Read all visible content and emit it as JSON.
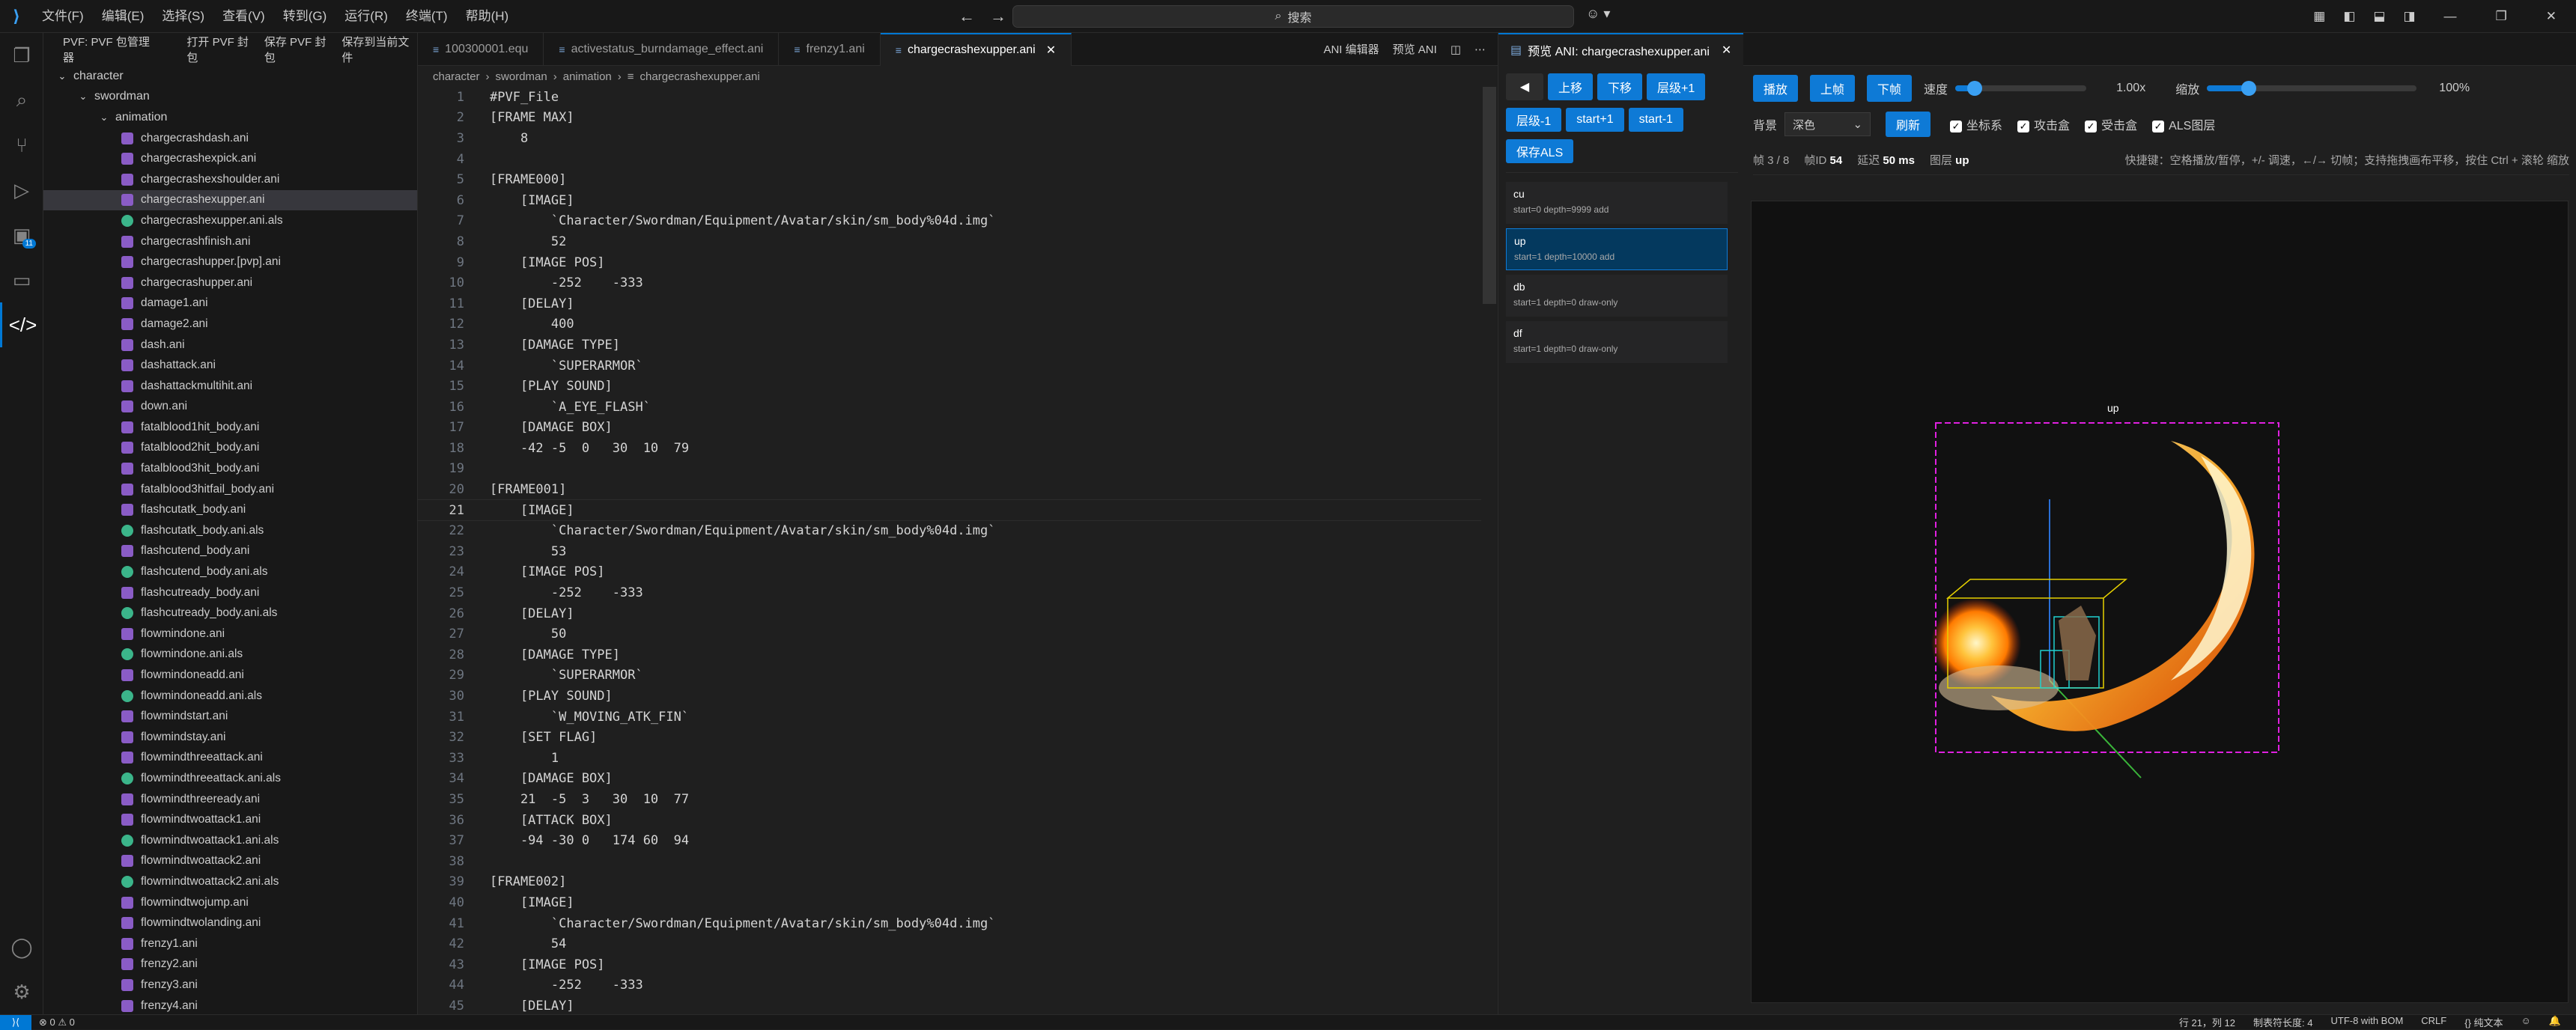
{
  "titlebar": {
    "menu": [
      "文件(F)",
      "编辑(E)",
      "选择(S)",
      "查看(V)",
      "转到(G)",
      "运行(R)",
      "终端(T)",
      "帮助(H)"
    ],
    "search_placeholder": "搜索"
  },
  "sidebar": {
    "header_items": [
      "PVF: PVF 包管理器",
      "打开 PVF 封包",
      "保存 PVF 封包",
      "保存到当前文件"
    ],
    "folders": [
      "character",
      "swordman",
      "animation"
    ],
    "files": [
      {
        "name": "chargecrashdash.ani",
        "type": "ani"
      },
      {
        "name": "chargecrashexpick.ani",
        "type": "ani"
      },
      {
        "name": "chargecrashexshoulder.ani",
        "type": "ani"
      },
      {
        "name": "chargecrashexupper.ani",
        "type": "ani",
        "selected": true
      },
      {
        "name": "chargecrashexupper.ani.als",
        "type": "als"
      },
      {
        "name": "chargecrashfinish.ani",
        "type": "ani"
      },
      {
        "name": "chargecrashupper.[pvp].ani",
        "type": "ani"
      },
      {
        "name": "chargecrashupper.ani",
        "type": "ani"
      },
      {
        "name": "damage1.ani",
        "type": "ani"
      },
      {
        "name": "damage2.ani",
        "type": "ani"
      },
      {
        "name": "dash.ani",
        "type": "ani"
      },
      {
        "name": "dashattack.ani",
        "type": "ani"
      },
      {
        "name": "dashattackmultihit.ani",
        "type": "ani"
      },
      {
        "name": "down.ani",
        "type": "ani"
      },
      {
        "name": "fatalblood1hit_body.ani",
        "type": "ani"
      },
      {
        "name": "fatalblood2hit_body.ani",
        "type": "ani"
      },
      {
        "name": "fatalblood3hit_body.ani",
        "type": "ani"
      },
      {
        "name": "fatalblood3hitfail_body.ani",
        "type": "ani"
      },
      {
        "name": "flashcutatk_body.ani",
        "type": "ani"
      },
      {
        "name": "flashcutatk_body.ani.als",
        "type": "als"
      },
      {
        "name": "flashcutend_body.ani",
        "type": "ani"
      },
      {
        "name": "flashcutend_body.ani.als",
        "type": "als"
      },
      {
        "name": "flashcutready_body.ani",
        "type": "ani"
      },
      {
        "name": "flashcutready_body.ani.als",
        "type": "als"
      },
      {
        "name": "flowmindone.ani",
        "type": "ani"
      },
      {
        "name": "flowmindone.ani.als",
        "type": "als"
      },
      {
        "name": "flowmindoneadd.ani",
        "type": "ani"
      },
      {
        "name": "flowmindoneadd.ani.als",
        "type": "als"
      },
      {
        "name": "flowmindstart.ani",
        "type": "ani"
      },
      {
        "name": "flowmindstay.ani",
        "type": "ani"
      },
      {
        "name": "flowmindthreeattack.ani",
        "type": "ani"
      },
      {
        "name": "flowmindthreeattack.ani.als",
        "type": "als"
      },
      {
        "name": "flowmindthreeready.ani",
        "type": "ani"
      },
      {
        "name": "flowmindtwoattack1.ani",
        "type": "ani"
      },
      {
        "name": "flowmindtwoattack1.ani.als",
        "type": "als"
      },
      {
        "name": "flowmindtwoattack2.ani",
        "type": "ani"
      },
      {
        "name": "flowmindtwoattack2.ani.als",
        "type": "als"
      },
      {
        "name": "flowmindtwojump.ani",
        "type": "ani"
      },
      {
        "name": "flowmindtwolanding.ani",
        "type": "ani"
      },
      {
        "name": "frenzy1.ani",
        "type": "ani"
      },
      {
        "name": "frenzy2.ani",
        "type": "ani"
      },
      {
        "name": "frenzy3.ani",
        "type": "ani"
      },
      {
        "name": "frenzy4.ani",
        "type": "ani"
      }
    ]
  },
  "editor": {
    "tabs": [
      "100300001.equ",
      "activestatus_burndamage_effect.ani",
      "frenzy1.ani",
      "chargecrashexupper.ani"
    ],
    "tab_actions": [
      "ANI 编辑器",
      "预览 ANI"
    ],
    "breadcrumb": [
      "character",
      "swordman",
      "animation",
      "chargecrashexupper.ani"
    ],
    "lines": [
      "#PVF_File",
      "[FRAME MAX]",
      "    8",
      "",
      "[FRAME000]",
      "    [IMAGE]",
      "        `Character/Swordman/Equipment/Avatar/skin/sm_body%04d.img`",
      "        52",
      "    [IMAGE POS]",
      "        -252    -333",
      "    [DELAY]",
      "        400",
      "    [DAMAGE TYPE]",
      "        `SUPERARMOR`",
      "    [PLAY SOUND]",
      "        `A_EYE_FLASH`",
      "    [DAMAGE BOX]",
      "    -42 -5  0   30  10  79",
      "",
      "[FRAME001]",
      "    [IMAGE]",
      "        `Character/Swordman/Equipment/Avatar/skin/sm_body%04d.img`",
      "        53",
      "    [IMAGE POS]",
      "        -252    -333",
      "    [DELAY]",
      "        50",
      "    [DAMAGE TYPE]",
      "        `SUPERARMOR`",
      "    [PLAY SOUND]",
      "        `W_MOVING_ATK_FIN`",
      "    [SET FLAG]",
      "        1",
      "    [DAMAGE BOX]",
      "    21  -5  3   30  10  77",
      "    [ATTACK BOX]",
      "    -94 -30 0   174 60  94",
      "",
      "[FRAME002]",
      "    [IMAGE]",
      "        `Character/Swordman/Equipment/Avatar/skin/sm_body%04d.img`",
      "        54",
      "    [IMAGE POS]",
      "        -252    -333",
      "    [DELAY]"
    ],
    "cursor_line": 21
  },
  "preview": {
    "tab_title": "预览 ANI: chargecrashexupper.ani",
    "left_buttons_row1": [
      "◀",
      "上移",
      "下移",
      "层级+1"
    ],
    "left_buttons_row2": [
      "层级-1",
      "start+1",
      "start-1"
    ],
    "left_buttons_row3": [
      "保存ALS"
    ],
    "layers": [
      {
        "name": "cu",
        "sub": "start=0 depth=9999 add"
      },
      {
        "name": "up",
        "sub": "start=1 depth=10000 add",
        "selected": true
      },
      {
        "name": "db",
        "sub": "start=1 depth=0 draw-only"
      },
      {
        "name": "df",
        "sub": "start=1 depth=0 draw-only"
      }
    ],
    "play_buttons": [
      "播放",
      "上帧",
      "下帧"
    ],
    "speed_label": "速度",
    "speed_value": "1.00x",
    "speed_fraction": 0.15,
    "zoom_label": "缩放",
    "zoom_value": "100%",
    "zoom_fraction": 0.2,
    "bg_label": "背景",
    "bg_value": "深色",
    "refresh_label": "刷新",
    "checkboxes": [
      "坐标系",
      "攻击盒",
      "受击盒",
      "ALS图层"
    ],
    "info_frame": "帧 3 / 8",
    "info_frameid_label": "帧ID",
    "info_frameid": "54",
    "info_delay_label": "延迟",
    "info_delay": "50 ms",
    "info_layer_label": "图层",
    "info_layer": "up",
    "info_shortcuts": "快捷键：空格播放/暂停，+/- 调速，←/→ 切帧；支持拖拽画布平移，按住 Ctrl + 滚轮 缩放",
    "canvas_layer_label": "up"
  },
  "statusbar": {
    "errors": "⊗ 0 ⚠ 0",
    "position": "行 21，列 12",
    "tab_size": "制表符长度: 4",
    "encoding": "UTF-8 with BOM",
    "eol": "CRLF",
    "language": "{} 纯文本"
  }
}
